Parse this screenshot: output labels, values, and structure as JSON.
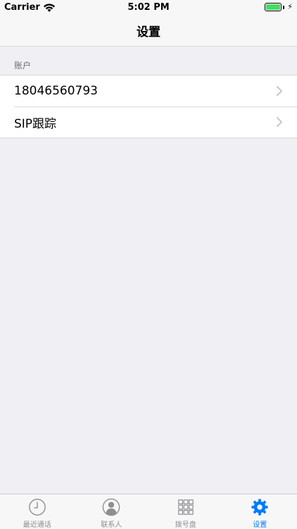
{
  "status_bar": {
    "carrier": "Carrier",
    "time": "5:02 PM",
    "battery_level": 1.0
  },
  "nav": {
    "title": "设置"
  },
  "account_section": {
    "header": "账户",
    "items": [
      {
        "label": "18046560793"
      },
      {
        "label": "SIP跟踪"
      }
    ]
  },
  "tab_bar": {
    "active_color": "#007aff",
    "inactive_color": "#8e8e93",
    "tabs": [
      {
        "label": "最近通话",
        "icon": "clock-icon"
      },
      {
        "label": "联系人",
        "icon": "contact-icon"
      },
      {
        "label": "拨号盘",
        "icon": "keypad-icon"
      },
      {
        "label": "设置",
        "icon": "gear-icon",
        "active": true
      }
    ]
  }
}
